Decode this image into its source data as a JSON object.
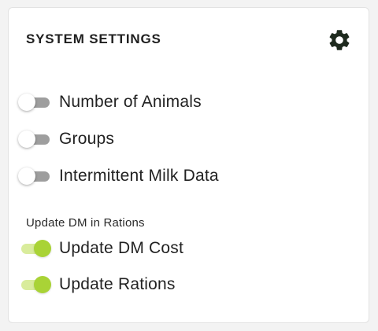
{
  "card": {
    "title": "SYSTEM SETTINGS",
    "settings_icon": "gear-icon"
  },
  "toggles": [
    {
      "label": "Number of Animals",
      "checked": false
    },
    {
      "label": "Groups",
      "checked": false
    },
    {
      "label": "Intermittent Milk Data",
      "checked": false
    }
  ],
  "dm_section": {
    "label": "Update DM in Rations",
    "toggles": [
      {
        "label": "Update DM Cost",
        "checked": true
      },
      {
        "label": "Update Rations",
        "checked": true
      }
    ]
  },
  "colors": {
    "accent_thumb": "#a9d336",
    "accent_track": "#d9ec9c",
    "off_track": "#9e9e9e"
  }
}
